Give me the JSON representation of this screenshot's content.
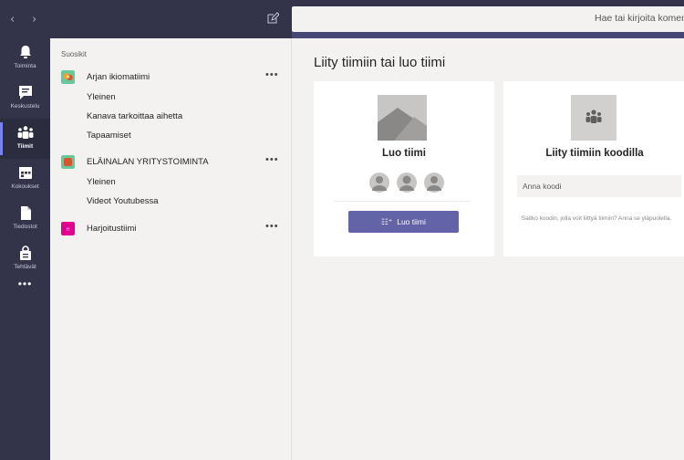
{
  "topbar": {
    "back_icon": "‹",
    "forward_icon": "›",
    "compose_icon": "compose-icon",
    "search_placeholder": "Hae tai kirjoita komen"
  },
  "rail": {
    "items": [
      {
        "label": "Toiminta",
        "icon": "bell-icon"
      },
      {
        "label": "Keskustelu",
        "icon": "chat-icon"
      },
      {
        "label": "Tiimit",
        "icon": "teams-icon",
        "active": true
      },
      {
        "label": "Kokoukset",
        "icon": "calendar-icon"
      },
      {
        "label": "Tiedostot",
        "icon": "files-icon"
      },
      {
        "label": "Tehtävät",
        "icon": "assignments-icon"
      }
    ],
    "more": "•••"
  },
  "panel": {
    "section_title": "Suosikit",
    "teams": [
      {
        "name": "Arjan ikiomatiimi",
        "more": "•••",
        "avatar_color": "#68c89a",
        "channels": [
          "Yleinen",
          "Kanava tarkoittaa aihetta",
          "Tapaamiset"
        ]
      },
      {
        "name": "ELÄINALAN YRITYSTOIMINTA",
        "more": "•••",
        "avatar_color": "#d4572d",
        "channels": [
          "Yleinen",
          "Videot Youtubessa"
        ]
      },
      {
        "name": "Harjoitustiimi",
        "more": "•••",
        "avatar_color": "#e3008c",
        "avatar_letter": "H",
        "channels": []
      }
    ]
  },
  "main": {
    "heading": "Liity tiimiin tai luo tiimi",
    "create_card": {
      "title": "Luo tiimi",
      "button_label": "Luo tiimi"
    },
    "join_card": {
      "title": "Liity tiimiin koodilla",
      "input_placeholder": "Anna koodi",
      "hint": "Saitko koodin, jolla voit liittyä tiimiin? Anna se yläpuolella."
    }
  },
  "colors": {
    "accent": "#6264a7",
    "rail_bg": "#33344a",
    "background": "#f3f2f1"
  }
}
